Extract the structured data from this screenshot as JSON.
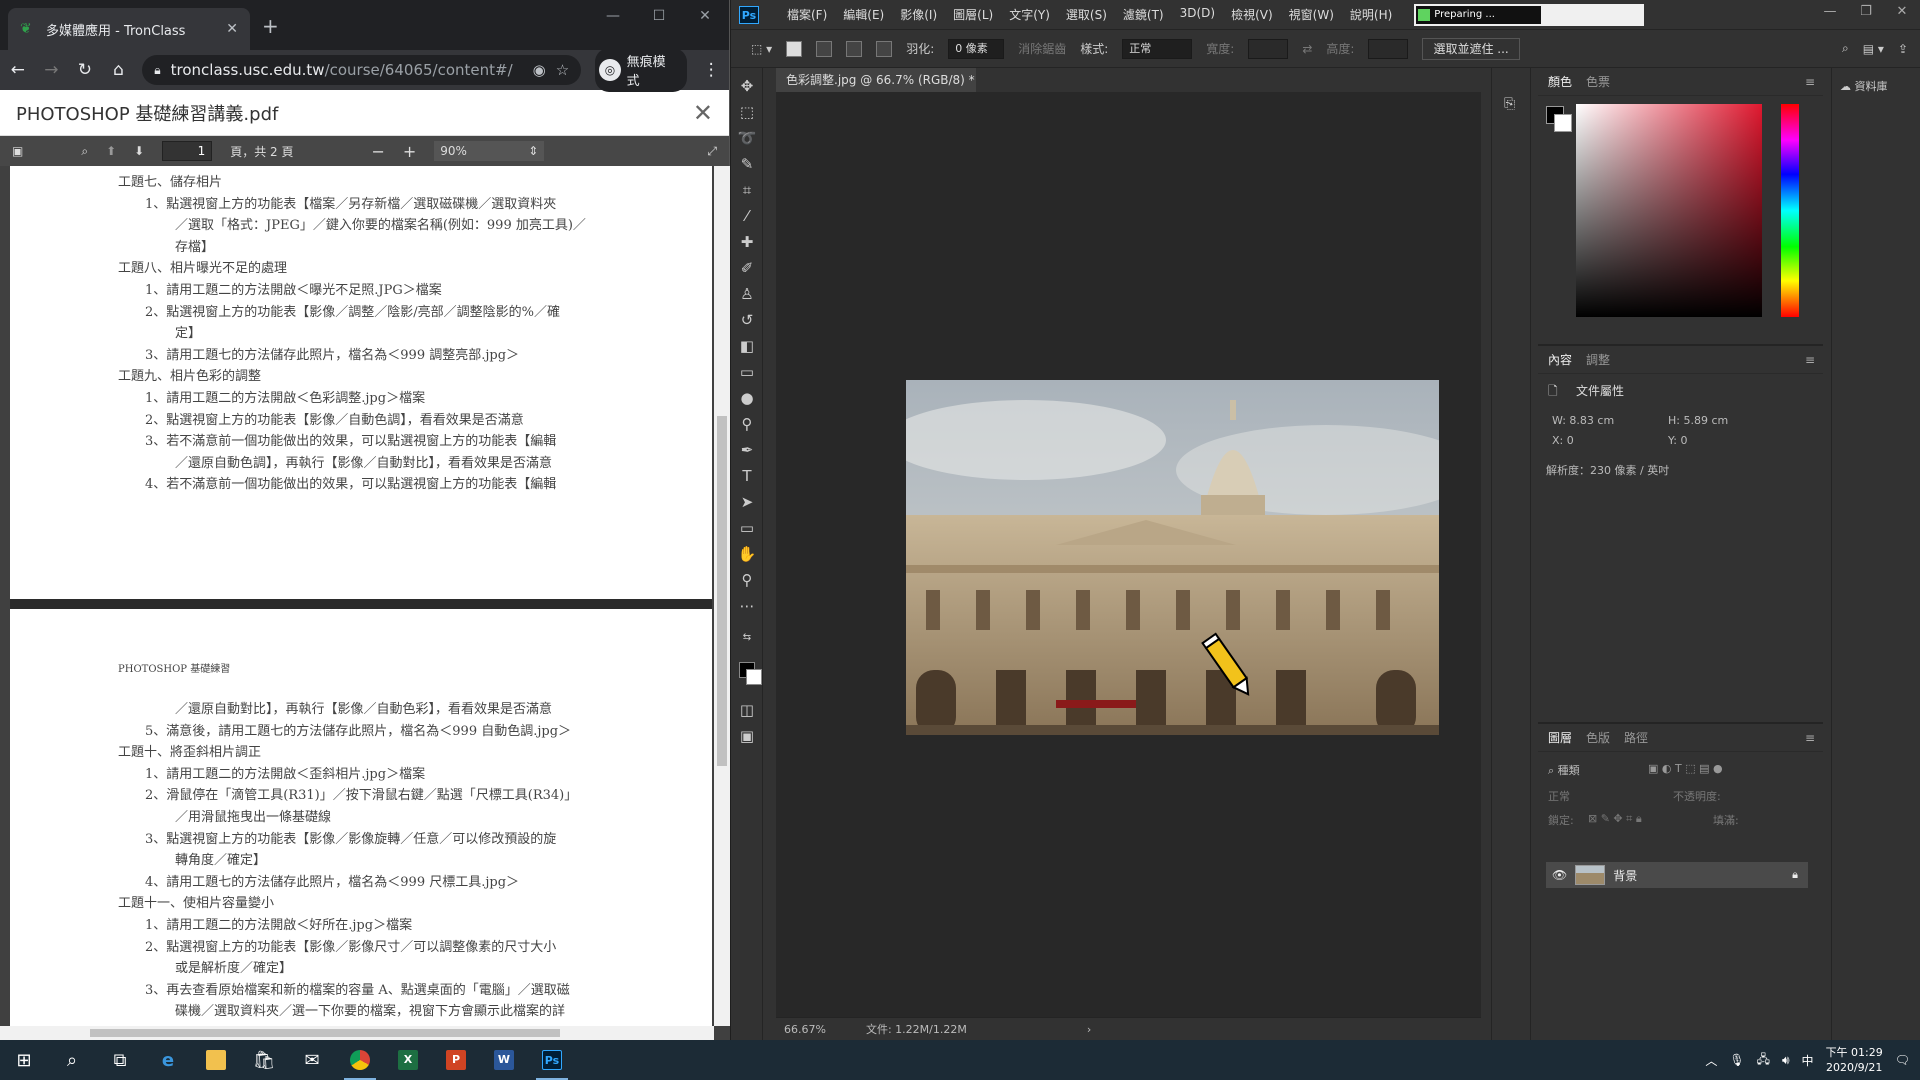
{
  "chrome": {
    "tab_title": "多媒體應用 - TronClass",
    "url_host": "tronclass.usc.edu.tw",
    "url_path": "/course/64065/content#/",
    "incognito_label": "無痕模式"
  },
  "pdf": {
    "filename": "PHOTOSHOP 基礎練習講義.pdf",
    "page_current": "1",
    "page_total_label": "頁，共 2 頁",
    "zoom": "90%",
    "page1_lines": [
      "工題七、儲存相片",
      "1、點選視窗上方的功能表【檔案／另存新檔／選取磁碟機／選取資料夾",
      "／選取「格式：JPEG」／鍵入你要的檔案名稱(例如：999 加亮工具)／",
      "存檔】",
      "工題八、相片曝光不足的處理",
      "1、請用工題二的方法開啟＜曝光不足照.JPG＞檔案",
      "2、點選視窗上方的功能表【影像／調整／陰影/亮部／調整陰影的%／確",
      "定】",
      "3、請用工題七的方法儲存此照片，檔名為＜999 調整亮部.jpg＞",
      "工題九、相片色彩的調整",
      "1、請用工題二的方法開啟＜色彩調整.jpg＞檔案",
      "2、點選視窗上方的功能表【影像／自動色調】，看看效果是否滿意",
      "3、若不滿意前一個功能做出的效果，可以點選視窗上方的功能表【編輯",
      "／還原自動色調】，再執行【影像／自動對比】，看看效果是否滿意",
      "4、若不滿意前一個功能做出的效果，可以點選視窗上方的功能表【編輯"
    ],
    "page2_header": "PHOTOSHOP 基礎練習",
    "page2_lines": [
      "／還原自動對比】，再執行【影像／自動色彩】，看看效果是否滿意",
      "5、滿意後，請用工題七的方法儲存此照片，檔名為＜999 自動色調.jpg＞",
      "工題十、將歪斜相片調正",
      "1、請用工題二的方法開啟＜歪斜相片.jpg＞檔案",
      "2、滑鼠停在「滴管工具(R31)」／按下滑鼠右鍵／點選「尺標工具(R34)」",
      "／用滑鼠拖曳出一條基礎線",
      "3、點選視窗上方的功能表【影像／影像旋轉／任意／可以修改預設的旋",
      "轉角度／確定】",
      "4、請用工題七的方法儲存此照片，檔名為＜999 尺標工具.jpg＞",
      "工題十一、使相片容量變小",
      "1、請用工題二的方法開啟＜好所在.jpg＞檔案",
      "2、點選視窗上方的功能表【影像／影像尺寸／可以調整像素的尺寸大小",
      "或是解析度／確定】",
      "3、再去查看原始檔案和新的檔案的容量 A、點選桌面的「電腦」／選取磁",
      "碟機／選取資料夾／選一下你要的檔案，視窗下方會顯示此檔案的詳"
    ]
  },
  "photoshop": {
    "menus": [
      "檔案(F)",
      "編輯(E)",
      "影像(I)",
      "圖層(L)",
      "文字(Y)",
      "選取(S)",
      "濾鏡(T)",
      "3D(D)",
      "檢視(V)",
      "視窗(W)",
      "說明(H)"
    ],
    "preparing": "Preparing ...",
    "options": {
      "feather_label": "羽化:",
      "feather_value": "0 像素",
      "antialias": "消除鋸齒",
      "style_label": "樣式:",
      "style_value": "正常",
      "width_label": "寬度:",
      "height_label": "高度:",
      "select_mask": "選取並遮住 ..."
    },
    "doc_tab": "色彩調整.jpg @ 66.7% (RGB/8) *",
    "status_zoom": "66.67%",
    "status_doc": "文件: 1.22M/1.22M",
    "color_tabs": [
      "顏色",
      "色票"
    ],
    "props_tabs": [
      "內容",
      "調整"
    ],
    "props_title": "文件屬性",
    "props": {
      "w": "W:  8.83 cm",
      "h": "H:  5.89 cm",
      "x": "X:  0",
      "y": "Y:  0",
      "res": "解析度：230 像素 / 英吋"
    },
    "layers_tabs": [
      "圖層",
      "色版",
      "路徑"
    ],
    "layers_search": "種類",
    "blend_mode": "正常",
    "opacity_label": "不透明度:",
    "lock_label": "鎖定:",
    "fill_label": "填滿:",
    "layer_name": "背景",
    "libraries": "資料庫"
  },
  "taskbar": {
    "ime": "中",
    "time": "下午 01:29",
    "date": "2020/9/21"
  }
}
